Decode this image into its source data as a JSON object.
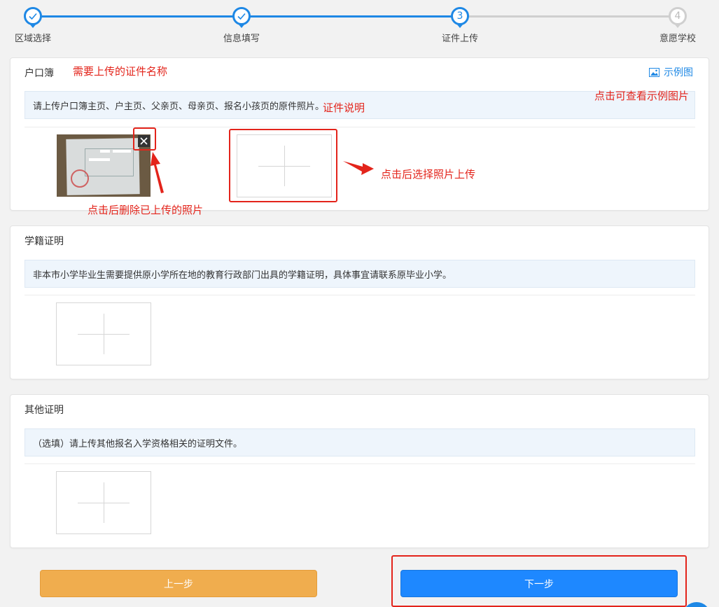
{
  "steps": [
    {
      "label": "区域选择",
      "state": "done"
    },
    {
      "label": "信息填写",
      "state": "done"
    },
    {
      "label": "证件上传",
      "state": "current",
      "number": "3"
    },
    {
      "label": "意愿学校",
      "state": "todo",
      "number": "4"
    }
  ],
  "cards": [
    {
      "title": "户口簿",
      "description": "请上传户口簿主页、户主页、父亲页、母亲页、报名小孩页的原件照片。",
      "example_link": "示例图"
    },
    {
      "title": "学籍证明",
      "description": "非本市小学毕业生需要提供原小学所在地的教育行政部门出具的学籍证明，具体事宜请联系原毕业小学。"
    },
    {
      "title": "其他证明",
      "description": "（选填）请上传其他报名入学资格相关的证明文件。"
    }
  ],
  "annotations": {
    "cert_name": "需要上传的证件名称",
    "cert_desc": "证件说明",
    "view_example": "点击可查看示例图片",
    "delete_photo": "点击后删除已上传的照片",
    "select_upload": "点击后选择照片上传"
  },
  "buttons": {
    "prev": "上一步",
    "next": "下一步"
  },
  "colors": {
    "accent": "#1e88e5",
    "annotation": "#e3241b",
    "prev_button": "#f0ad4e",
    "next_button": "#1e88ff"
  },
  "icons": [
    "check-icon",
    "image-icon",
    "close-icon",
    "plus-icon",
    "arrow-icon"
  ]
}
